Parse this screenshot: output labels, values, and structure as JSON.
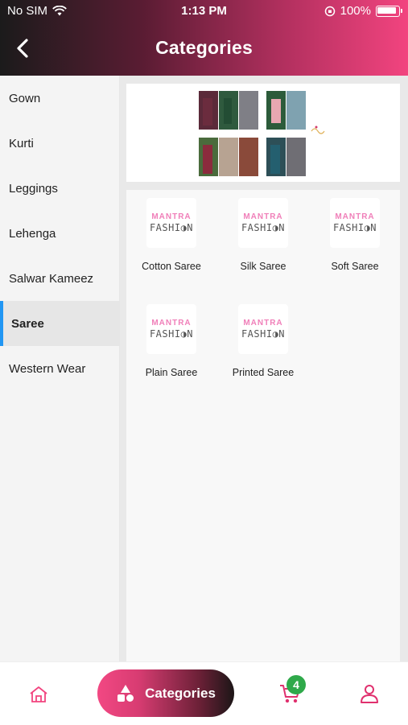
{
  "status_bar": {
    "carrier": "No SIM",
    "time": "1:13 PM",
    "battery": "100%"
  },
  "header": {
    "title": "Categories",
    "back_icon": "chevron-left-icon"
  },
  "sidebar": {
    "items": [
      {
        "label": "Gown"
      },
      {
        "label": "Kurti"
      },
      {
        "label": "Leggings"
      },
      {
        "label": "Lehenga"
      },
      {
        "label": "Salwar Kameez"
      },
      {
        "label": "Saree",
        "active": true
      },
      {
        "label": "Western Wear"
      }
    ]
  },
  "main": {
    "banner_icon": "saree-collage-image",
    "categories": [
      {
        "label": "Cotton Saree",
        "logo_top": "MANTRA",
        "logo_bottom": "FASHI◑N"
      },
      {
        "label": "Silk Saree",
        "logo_top": "MANTRA",
        "logo_bottom": "FASHI◑N"
      },
      {
        "label": "Soft Saree",
        "logo_top": "MANTRA",
        "logo_bottom": "FASHI◑N"
      },
      {
        "label": "Plain Saree",
        "logo_top": "MANTRA",
        "logo_bottom": "FASHI◑N"
      },
      {
        "label": "Printed Saree",
        "logo_top": "MANTRA",
        "logo_bottom": "FASHI◑N"
      }
    ]
  },
  "bottom_nav": {
    "home_icon": "home-icon",
    "categories_label": "Categories",
    "cart_count": "4",
    "profile_icon": "user-icon"
  },
  "colors": {
    "accent_pink": "#f2447f",
    "active_indicator": "#2196f3",
    "badge_green": "#2fa94a"
  }
}
